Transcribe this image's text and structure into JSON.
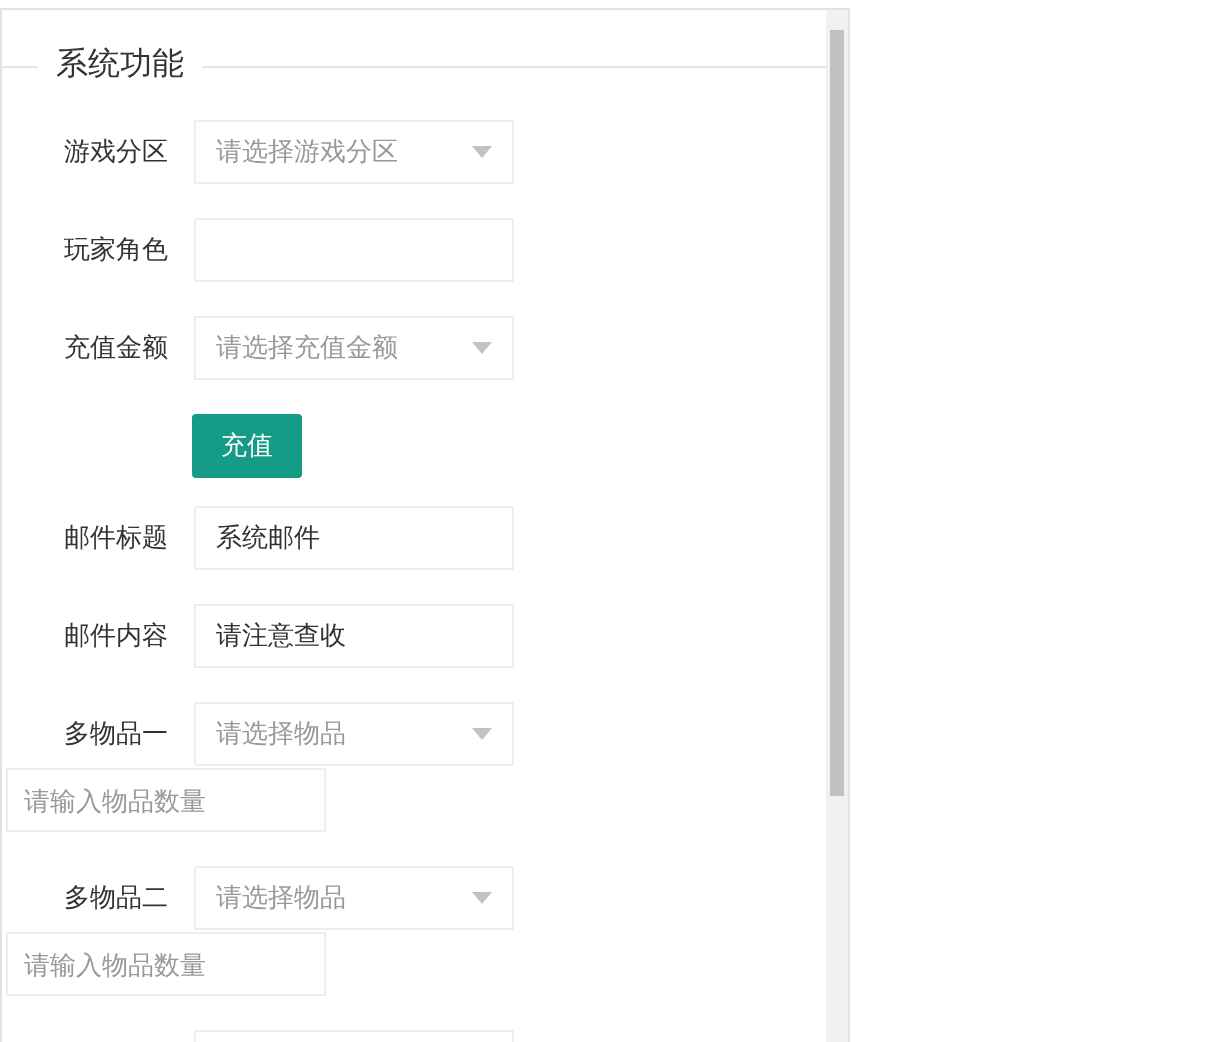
{
  "legend": "系统功能",
  "rows": [
    {
      "kind": "select",
      "label": "游戏分区",
      "placeholder": "请选择游戏分区"
    },
    {
      "kind": "input",
      "label": "玩家角色"
    },
    {
      "kind": "select",
      "label": "充值金额",
      "placeholder": "请选择充值金额"
    },
    {
      "kind": "button",
      "label": "充值"
    },
    {
      "kind": "input",
      "label": "邮件标题",
      "value": "系统邮件"
    },
    {
      "kind": "input",
      "label": "邮件内容",
      "value": "请注意查收"
    },
    {
      "kind": "item",
      "label": "多物品一",
      "placeholder": "请选择物品",
      "quantity_placeholder": "请输入物品数量"
    },
    {
      "kind": "item",
      "label": "多物品二",
      "placeholder": "请选择物品",
      "quantity_placeholder": "请输入物品数量"
    }
  ]
}
